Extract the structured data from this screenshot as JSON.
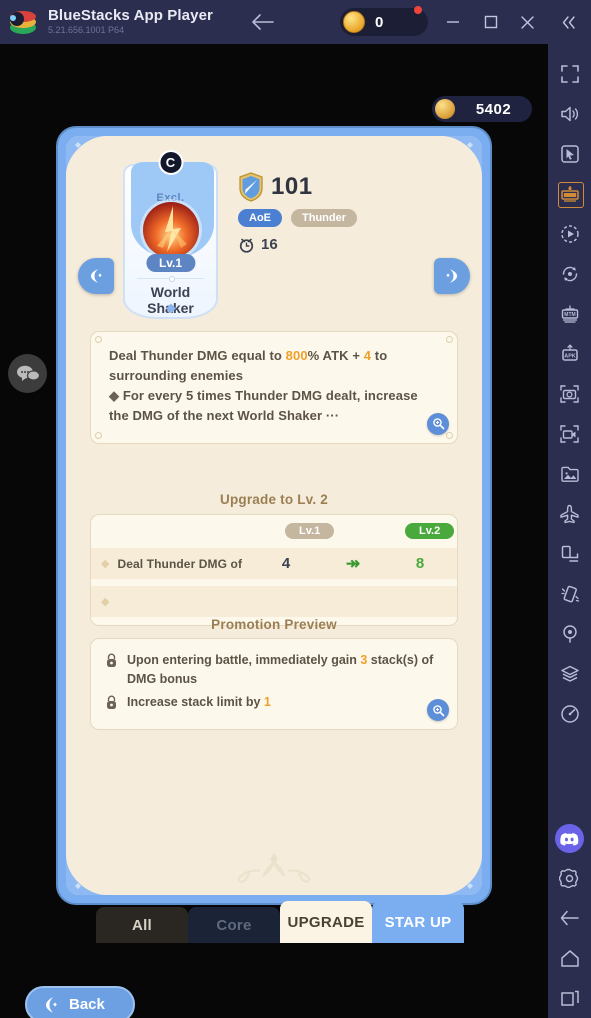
{
  "titlebar": {
    "app_name": "BlueStacks App Player",
    "version": "5.21.656.1001  P64",
    "back_icon": "arrow-left-icon",
    "coin_count": "0",
    "minimize_icon": "minimize-icon",
    "maximize_icon": "maximize-icon",
    "close_icon": "close-icon",
    "collapse_icon": "double-chevron-left-icon"
  },
  "hud": {
    "currency": "5402",
    "currency_icon": "gold-coin-icon",
    "chat_icon": "chat-bubbles-icon"
  },
  "card": {
    "nav_prev_icon": "prev-arrow-icon",
    "nav_next_icon": "next-arrow-icon",
    "hero": {
      "rank": "C",
      "exclusive_label": "Excl.",
      "level_badge": "Lv.1",
      "name_line1": "World",
      "name_line2": "Shaker"
    },
    "stats": {
      "attack_icon": "shield-sword-icon",
      "attack_value": "101",
      "tag_aoe": "AoE",
      "tag_element": "Thunder",
      "cooldown_icon": "stopwatch-icon",
      "cooldown_value": "16"
    },
    "description": {
      "line1_a": "Deal Thunder DMG equal to ",
      "line1_pct": "800",
      "line1_b": "% ATK + ",
      "line1_plus": "4",
      "line1_c": " to surrounding enemies",
      "bullet_glyph": "◆",
      "line2": " For every 5 times Thunder DMG dealt, increase the DMG of the next World Shaker ",
      "ellipsis": "···",
      "zoom_icon": "magnifier-icon"
    },
    "upgrade": {
      "title": "Upgrade to Lv. 2",
      "col_current": "Lv.1",
      "col_next": "Lv.2",
      "rows": [
        {
          "label": "Deal Thunder DMG of",
          "current": "4",
          "arrow": "↠",
          "next": "8"
        },
        {
          "label": "",
          "current": "",
          "arrow": "",
          "next": ""
        }
      ]
    },
    "promotion": {
      "title": "Promotion Preview",
      "items": [
        {
          "icon": "lock-icon",
          "text_a": "Upon entering battle, immediately gain ",
          "num": "3",
          "text_b": " stack(s) of DMG bonus"
        },
        {
          "icon": "lock-icon",
          "text_a": "Increase stack limit by ",
          "num": "1",
          "text_b": ""
        }
      ],
      "zoom_icon": "magnifier-icon"
    },
    "ornament_icon": "filigree-ornament-icon"
  },
  "tabs": [
    {
      "label": "All",
      "name": "tab-all",
      "state": "inactive"
    },
    {
      "label": "Core",
      "name": "tab-core",
      "state": "inactive"
    },
    {
      "label": "UPGRADE",
      "name": "tab-upgrade",
      "state": "active"
    },
    {
      "label": "STAR UP",
      "name": "tab-star-up",
      "state": "selected"
    }
  ],
  "back_button": {
    "label": "Back",
    "icon": "back-chevron-icon"
  },
  "sidebar": {
    "items": [
      {
        "name": "fullscreen-icon",
        "label": "Fullscreen"
      },
      {
        "name": "volume-icon",
        "label": "Volume"
      },
      {
        "name": "cursor-pointer-icon",
        "label": "Pointer"
      },
      {
        "name": "keyboard-controls-icon",
        "label": "Game controls"
      },
      {
        "name": "macro-record-icon",
        "label": "Macro"
      },
      {
        "name": "sync-operations-icon",
        "label": "Sync"
      },
      {
        "name": "multi-instance-icon",
        "label": "Multi-instance"
      },
      {
        "name": "apk-install-icon",
        "label": "Install APK"
      },
      {
        "name": "screenshot-icon",
        "label": "Screenshot"
      },
      {
        "name": "screen-record-icon",
        "label": "Record screen"
      },
      {
        "name": "media-manager-icon",
        "label": "Media manager"
      },
      {
        "name": "eco-mode-icon",
        "label": "Eco mode"
      },
      {
        "name": "rotate-screen-icon",
        "label": "Rotate"
      },
      {
        "name": "shake-icon",
        "label": "Shake"
      },
      {
        "name": "location-icon",
        "label": "Location"
      },
      {
        "name": "layers-icon",
        "label": "Layers"
      },
      {
        "name": "performance-icon",
        "label": "Performance"
      }
    ],
    "footer_items": [
      {
        "name": "discord-icon",
        "label": "Discord"
      },
      {
        "name": "settings-gear-icon",
        "label": "Settings"
      },
      {
        "name": "android-back-icon",
        "label": "Back"
      },
      {
        "name": "android-home-icon",
        "label": "Home"
      },
      {
        "name": "android-recents-icon",
        "label": "Recents"
      }
    ]
  },
  "colors": {
    "titlebar_bg": "#2b2e4f",
    "card_frame": "#7aaef0",
    "card_bg": "#f5ecdb",
    "panel_bg": "#fdf8ec",
    "accent_orange": "#f0a028",
    "accent_green": "#4aa93c",
    "tag_aoe": "#4a7fd1",
    "tag_thunder": "#c5b6a0"
  }
}
